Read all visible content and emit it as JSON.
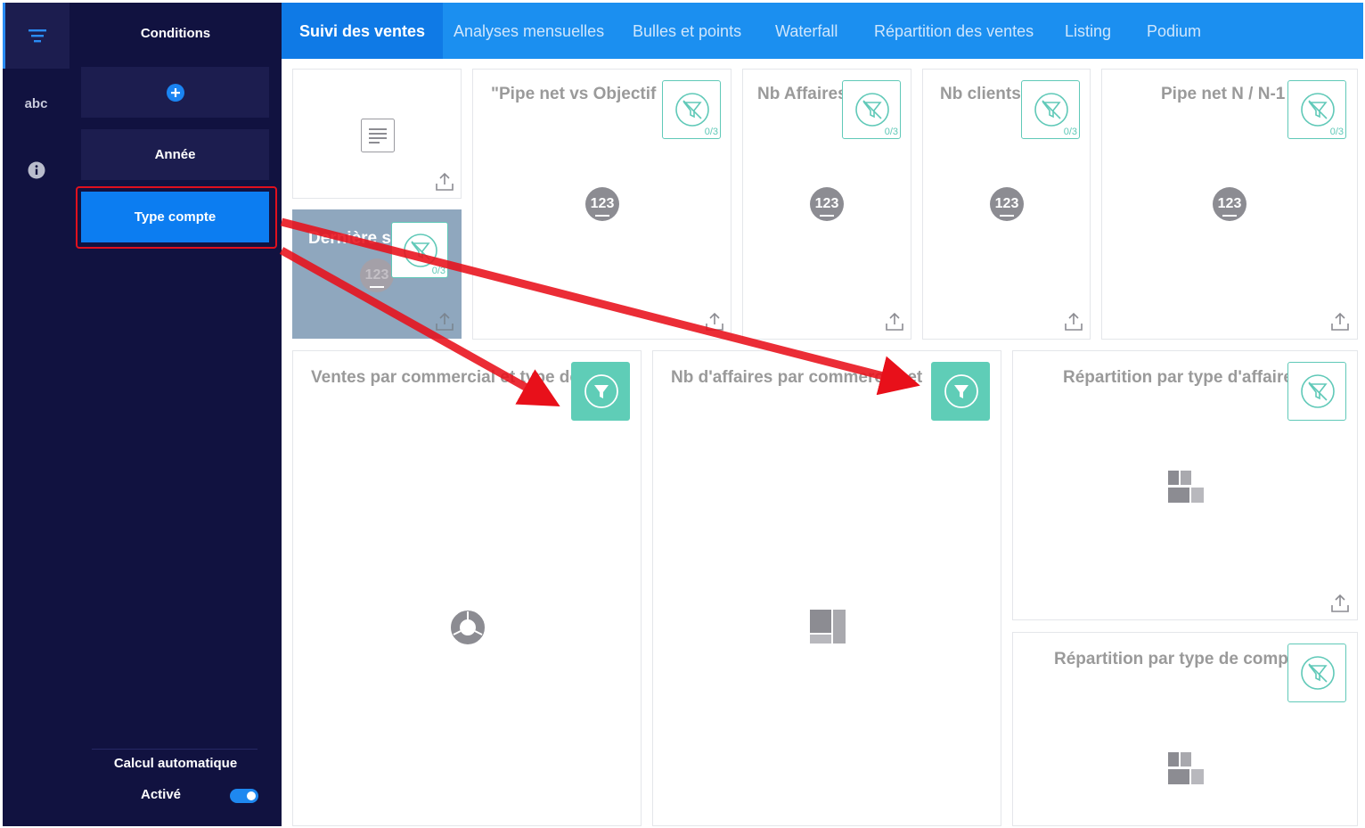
{
  "rail": {
    "items": [
      {
        "icon": "filter-lines-icon"
      },
      {
        "label": "abc"
      },
      {
        "icon": "info-icon"
      }
    ]
  },
  "panel": {
    "title": "Conditions",
    "conditions": [
      "Année",
      "Type compte"
    ],
    "auto_calc_label": "Calcul automatique",
    "auto_calc_state": "Activé"
  },
  "tabs": [
    "Suivi des ventes",
    "Analyses mensuelles",
    "Bulles et points",
    "Waterfall",
    "Répartition des ventes",
    "Listing",
    "Podium"
  ],
  "widgets": {
    "pipe_vs_objectif": {
      "title": "\"Pipe net vs Objectif",
      "filter_count": "0/3"
    },
    "nb_affaires": {
      "title": "Nb Affaires",
      "filter_count": "0/3"
    },
    "nb_clients": {
      "title": "Nb clients",
      "filter_count": "0/3"
    },
    "pipe_n": {
      "title": "Pipe net N / N-1",
      "filter_count": "0/3"
    },
    "derniere": {
      "title": "Dernière s",
      "filter_count": "0/3",
      "icon_text": "123"
    },
    "ventes_commercial": {
      "title": "Ventes par commercial et type de"
    },
    "nb_affaires_commercial": {
      "title": "Nb d'affaires par commercial et"
    },
    "repartition_affaire": {
      "title": "Répartition par type d'affaire"
    },
    "repartition_compte": {
      "title": "Répartition par type de compte"
    },
    "kpi_icon_text": "123"
  },
  "colors": {
    "navy": "#111240",
    "accent": "#0c7df1",
    "teal": "#5fcdb7",
    "arrow": "#e8101a"
  }
}
